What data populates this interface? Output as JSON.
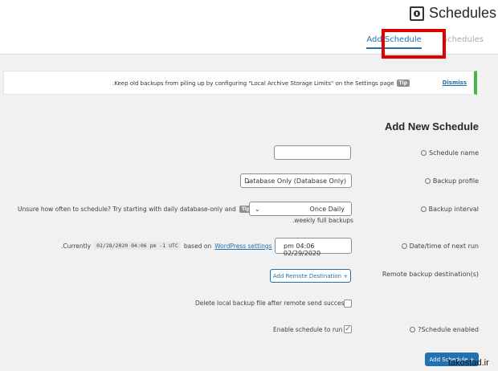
{
  "header": {
    "title": "Schedules",
    "tabs": [
      {
        "label": "Add Schedule",
        "active": true
      },
      {
        "label": "Schedules",
        "active": false
      }
    ]
  },
  "notice": {
    "message": ".Keep old backups from piling up by configuring \"Local Archive Storage Limits\" on the Settings page",
    "tip": "Tip",
    "dismiss": "Dismiss"
  },
  "form": {
    "title": "Add New Schedule",
    "schedule_name": {
      "label": "Schedule name",
      "value": ""
    },
    "backup_profile": {
      "label": "Backup profile",
      "value": "Database Only (Database Only)"
    },
    "backup_interval": {
      "label": "Backup interval",
      "hint": "Unsure how often to schedule? Try starting with daily database-only and",
      "tip": "Tip",
      "value": "Once Daily",
      "note": ".weekly full backups"
    },
    "next_run": {
      "label": "Date/time of next run",
      "currently": ".Currently",
      "current_value": "02/28/2020 04:06 pm -1 UTC",
      "based_on": "based on",
      "link": "WordPress settings",
      "value": "pm 04:06 02/29/2020"
    },
    "remote": {
      "label": "Remote backup destination(s)",
      "button": "Add Remote Destination +"
    },
    "delete_local": {
      "label": "Delete local backup file after remote send success",
      "checked": false
    },
    "enabled": {
      "label": "?Schedule enabled",
      "checkbox_label": "Enable schedule to run",
      "checked": true
    },
    "submit": "Add Schedule +"
  },
  "watermark": "takostad.ir",
  "colors": {
    "accent": "#2271b1",
    "highlight": "#e00000",
    "notice_border": "#46b450"
  }
}
